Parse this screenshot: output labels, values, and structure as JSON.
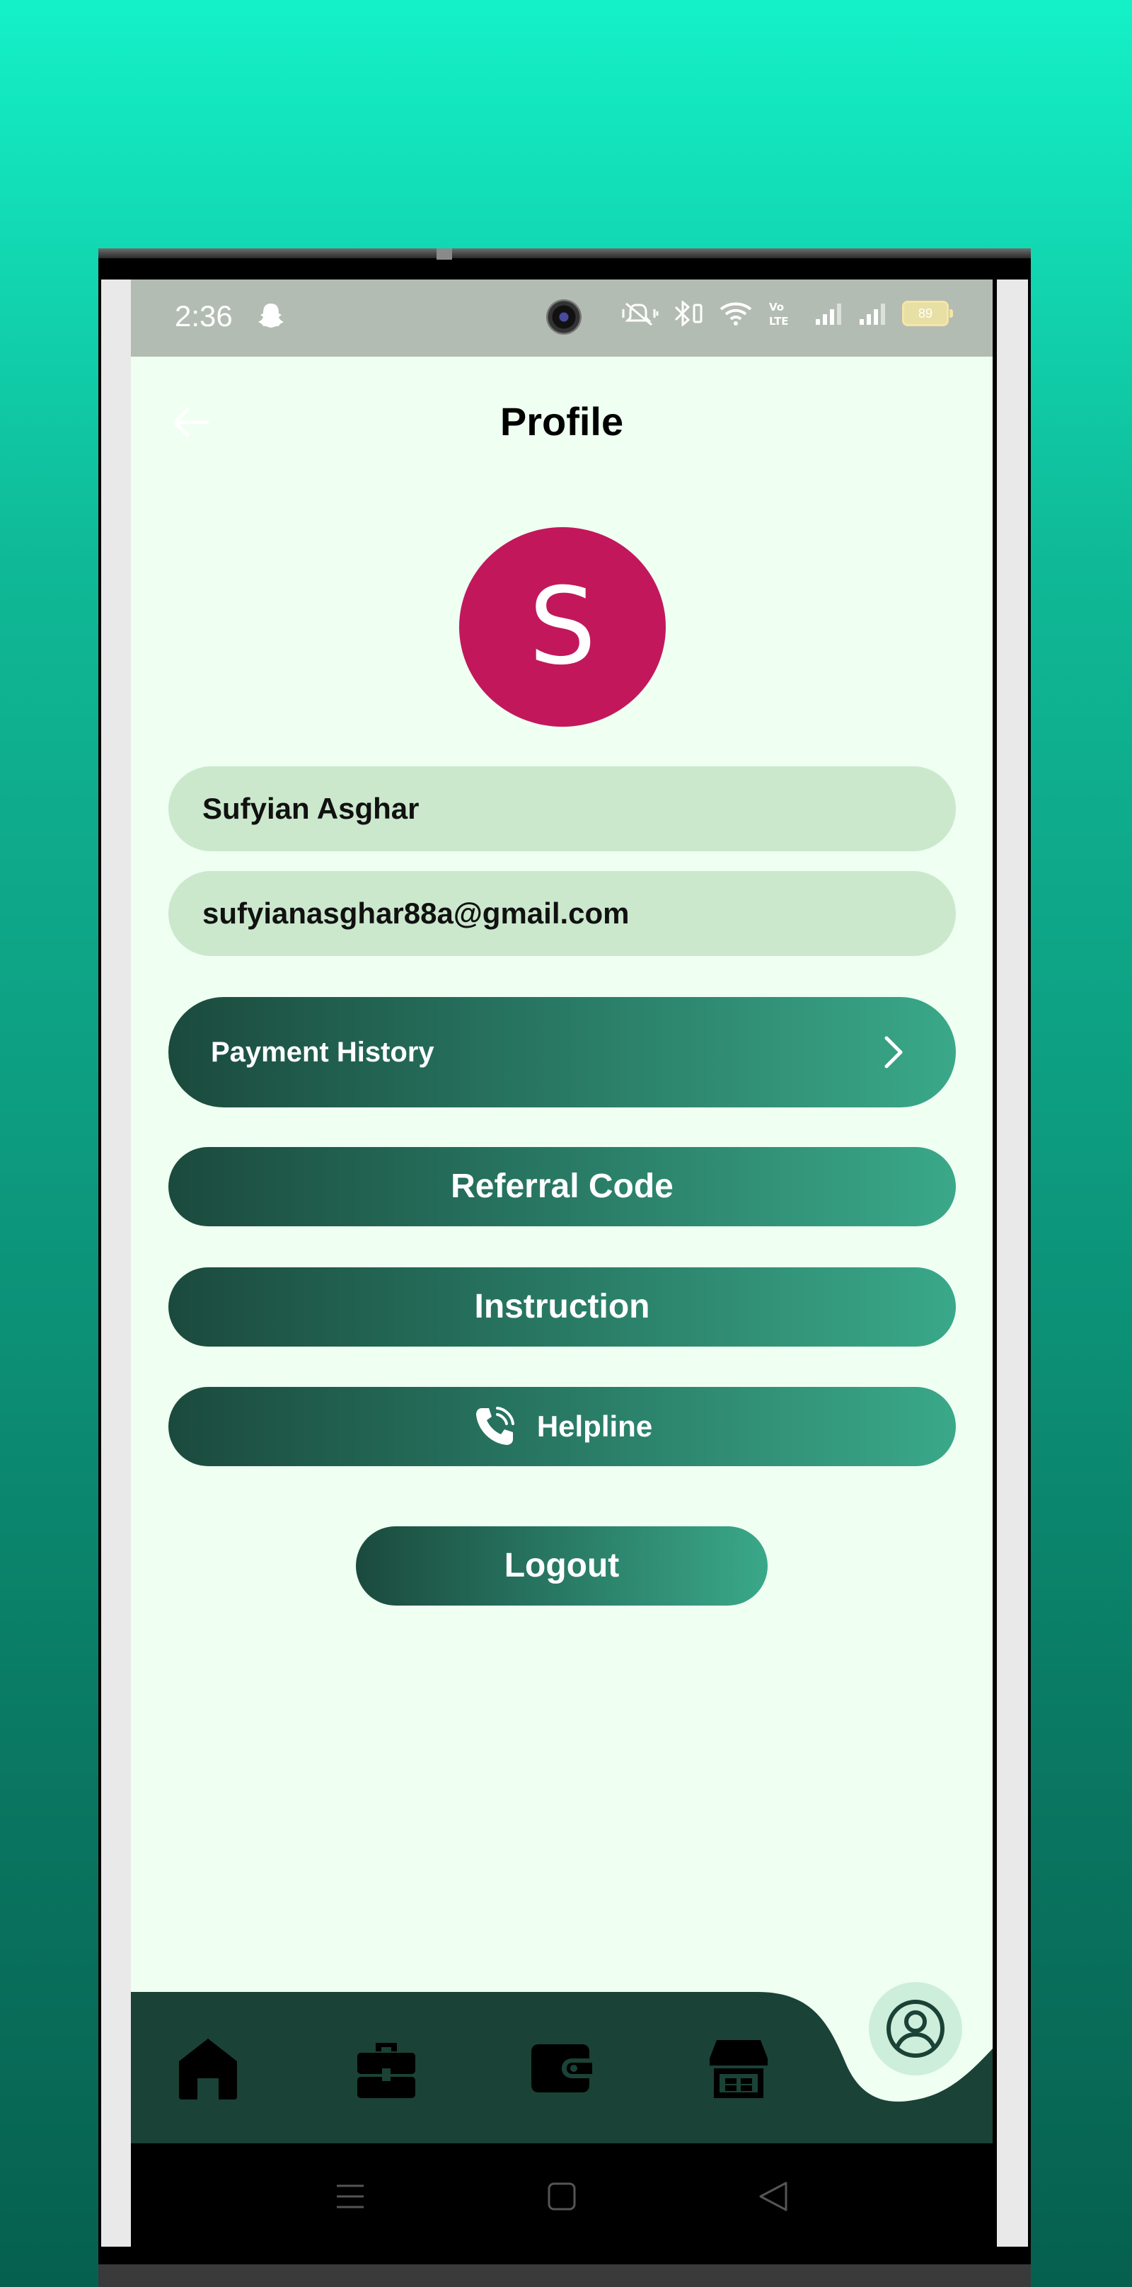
{
  "status_bar": {
    "time": "2:36",
    "battery": "89",
    "icons": [
      "snapchat-ghost-icon",
      "front-camera",
      "vibrate-mute-icon",
      "bluetooth-icon",
      "wifi-icon",
      "volte-icon",
      "signal-icon",
      "signal-icon",
      "battery-icon"
    ]
  },
  "header": {
    "title": "Profile",
    "back_icon": "back-arrow-icon"
  },
  "profile": {
    "avatar_initial": "S",
    "avatar_color": "#c2185b",
    "name": "Sufyian Asghar",
    "email": "sufyianasghar88a@gmail.com"
  },
  "menu": {
    "payment_history": "Payment History",
    "referral_code": "Referral Code",
    "instruction": "Instruction",
    "helpline": "Helpline"
  },
  "logout_label": "Logout",
  "bottom_nav": {
    "items": [
      "home-icon",
      "briefcase-icon",
      "wallet-icon",
      "store-icon",
      "profile-icon"
    ],
    "active": "profile-icon"
  },
  "colors": {
    "screen_background": "#effff2",
    "field_background": "#cbe8cd",
    "button_gradient_start": "#1b4a3d",
    "button_gradient_end": "#3aa889",
    "nav_background": "#1b4236"
  }
}
